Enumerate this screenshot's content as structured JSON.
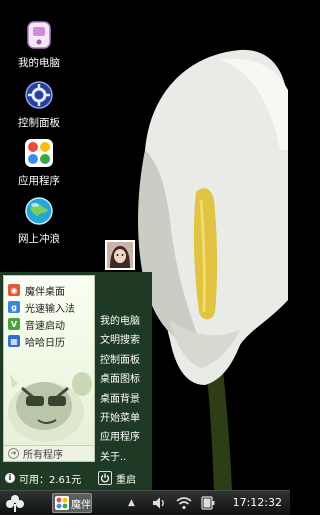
{
  "desktop": {
    "icons": [
      {
        "label": "我的电脑",
        "icon": "computer-icon"
      },
      {
        "label": "控制面板",
        "icon": "control-panel-icon"
      },
      {
        "label": "应用程序",
        "icon": "apps-icon"
      },
      {
        "label": "网上冲浪",
        "icon": "globe-icon"
      }
    ]
  },
  "start_menu": {
    "left_items": [
      {
        "label": "魔伴桌面",
        "icon": "mobile-desktop-icon",
        "color": "#e05a3a"
      },
      {
        "label": "光速输入法",
        "icon": "input-method-icon",
        "color": "#3a86e0"
      },
      {
        "label": "音速启动",
        "icon": "quick-launch-icon",
        "color": "#4aa33a"
      },
      {
        "label": "哈哈日历",
        "icon": "calendar-icon",
        "color": "#2f6fd0"
      }
    ],
    "all_programs": "所有程序",
    "right_items": [
      "我的电脑",
      "文明搜索",
      "控制面板",
      "桌面图标",
      "桌面背景",
      "开始菜单",
      "应用程序",
      "关于.."
    ],
    "memory_label": "可用：2.61元",
    "reboot_label": "重启"
  },
  "taskbar": {
    "app_label": "魔伴",
    "tray_arrow": "▲",
    "clock": "17:12:32"
  },
  "colors": {
    "menu_bg": "#1f3a24",
    "taskbar": "#1c1f1d"
  }
}
